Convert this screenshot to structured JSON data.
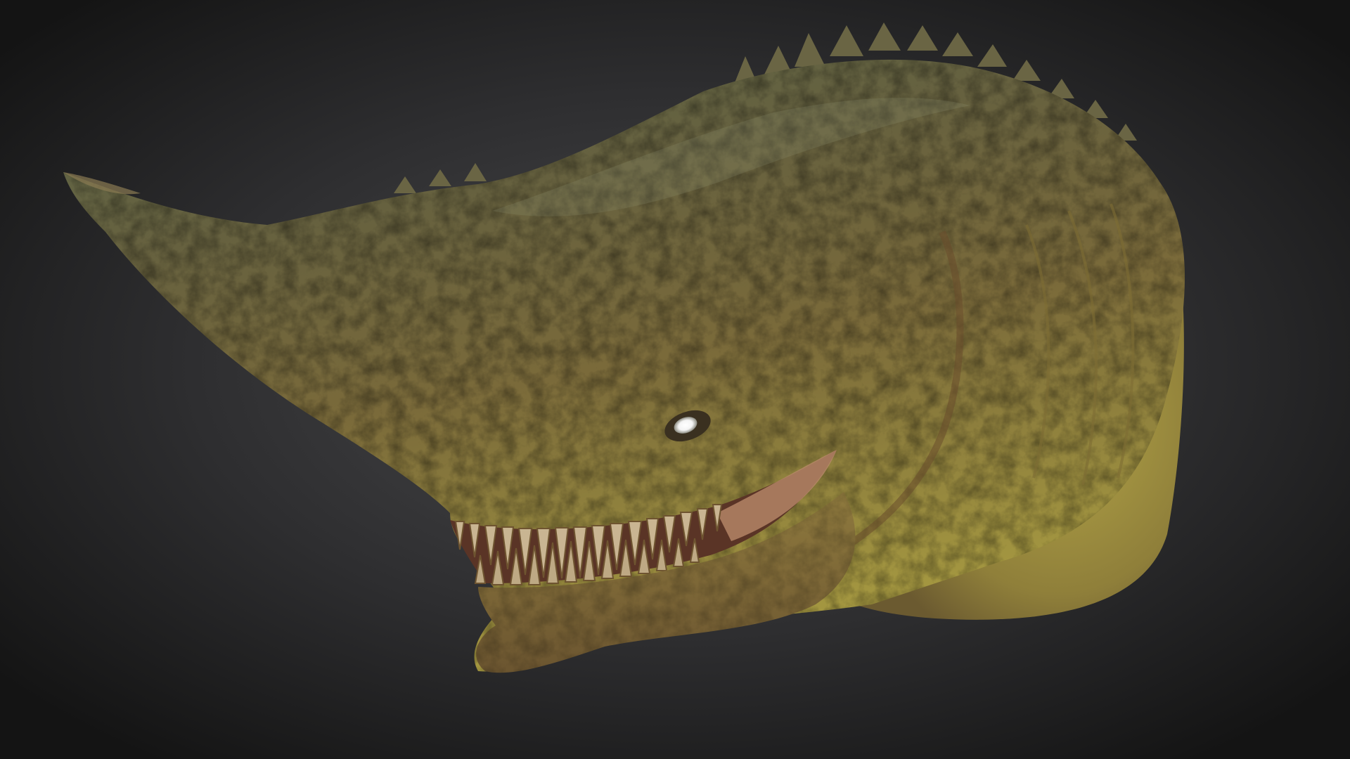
{
  "viewer": {
    "colors": {
      "background_center": "#4a4a4c",
      "background_edge": "#141414",
      "skin_top": "#5d6648",
      "skin_mid": "#7a6a3a",
      "skin_belly": "#a39640",
      "teeth": "#c9b592",
      "eye": "#f4f4f4"
    }
  }
}
